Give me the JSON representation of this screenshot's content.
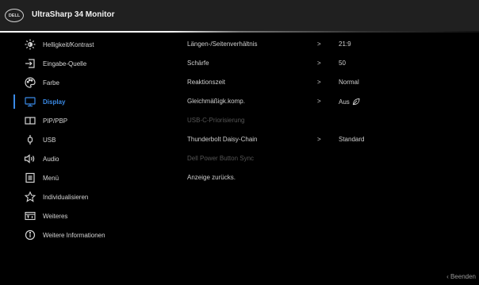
{
  "header": {
    "logo_text": "DELL",
    "title": "UltraSharp 34 Monitor"
  },
  "colors": {
    "accent": "#3a8ae6",
    "background": "#000000",
    "header": "#202020",
    "text": "#d5d5d5",
    "disabled": "#555555"
  },
  "sidebar": {
    "items": [
      {
        "label": "Helligkeit/Kontrast",
        "icon": "brightness-icon",
        "active": false
      },
      {
        "label": "Eingabe-Quelle",
        "icon": "input-source-icon",
        "active": false
      },
      {
        "label": "Farbe",
        "icon": "color-palette-icon",
        "active": false
      },
      {
        "label": "Display",
        "icon": "display-icon",
        "active": true
      },
      {
        "label": "PIP/PBP",
        "icon": "pip-pbp-icon",
        "active": false
      },
      {
        "label": "USB",
        "icon": "usb-icon",
        "active": false
      },
      {
        "label": "Audio",
        "icon": "audio-icon",
        "active": false
      },
      {
        "label": "Menü",
        "icon": "menu-icon",
        "active": false
      },
      {
        "label": "Individualisieren",
        "icon": "star-icon",
        "active": false
      },
      {
        "label": "Weiteres",
        "icon": "others-icon",
        "active": false
      },
      {
        "label": "Weitere Informationen",
        "icon": "info-icon",
        "active": false
      }
    ]
  },
  "settings": {
    "rows": [
      {
        "name": "Längen-/Seitenverhältnis",
        "chevron": ">",
        "value": "21:9",
        "enabled": true
      },
      {
        "name": "Schärfe",
        "chevron": ">",
        "value": "50",
        "enabled": true
      },
      {
        "name": "Reaktionszeit",
        "chevron": ">",
        "value": "Normal",
        "enabled": true
      },
      {
        "name": "Gleichmäßigk.komp.",
        "chevron": ">",
        "value": "Aus",
        "value_icon": "leaf-icon",
        "enabled": true
      },
      {
        "name": "USB-C-Priorisierung",
        "chevron": "",
        "value": "",
        "enabled": false
      },
      {
        "name": "Thunderbolt Daisy-Chain",
        "chevron": ">",
        "value": "Standard",
        "enabled": true
      },
      {
        "name": "Dell Power Button Sync",
        "chevron": "",
        "value": "",
        "enabled": false
      },
      {
        "name": "Anzeige zurücks.",
        "chevron": "",
        "value": "",
        "enabled": true
      }
    ]
  },
  "footer": {
    "exit_label": "Beenden",
    "exit_icon": "chevron-left-icon"
  }
}
